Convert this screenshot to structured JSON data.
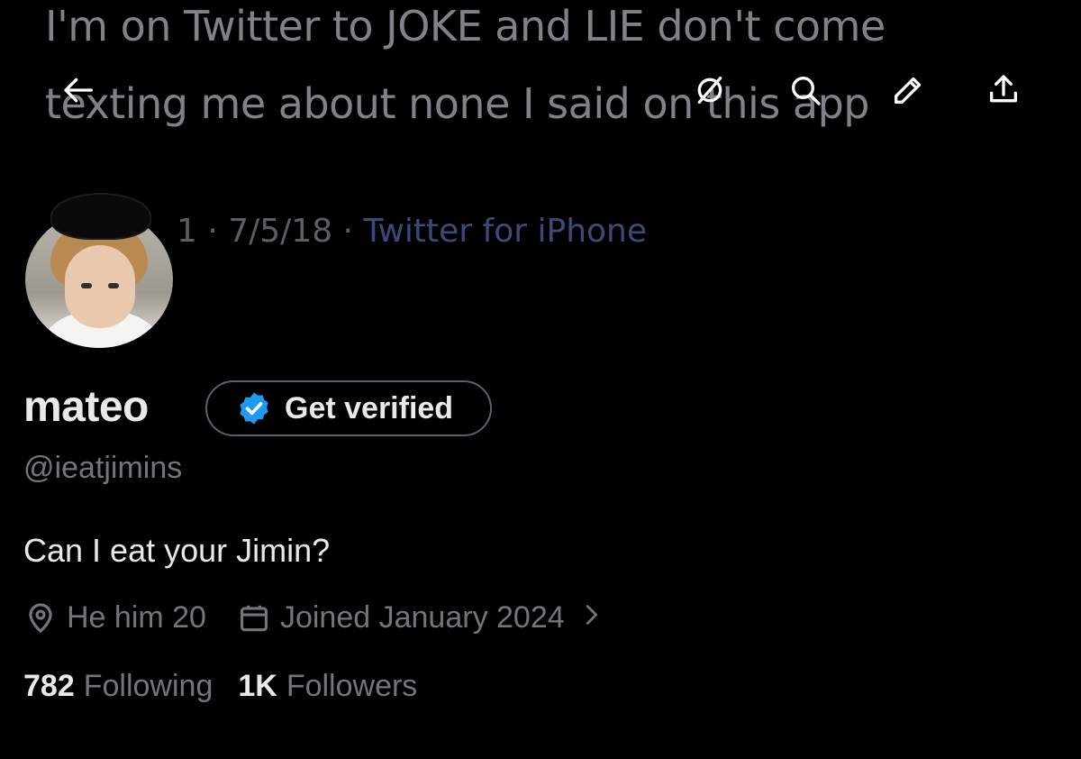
{
  "banner": {
    "line1": "I'm on Twitter to JOKE and LIE don't come",
    "line2": "texting me about none I said on this app",
    "meta_date": "1 · 7/5/18 · ",
    "meta_source": "Twitter for iPhone"
  },
  "nav": {
    "back_icon": "arrow-left-icon",
    "grok_icon": "grok-icon",
    "search_icon": "search-icon",
    "edit_icon": "pencil-icon",
    "share_icon": "share-icon"
  },
  "profile": {
    "display_name": "mateo",
    "get_verified_label": "Get verified",
    "handle": "@ieatjimins",
    "bio": "Can I eat your Jimin?",
    "location": "He him 20",
    "joined": "Joined January 2024",
    "following_count": "782",
    "following_label": "Following",
    "followers_count": "1K",
    "followers_label": "Followers"
  },
  "colors": {
    "background": "#000000",
    "primary_text": "#e7e9ea",
    "secondary_text": "#71767b",
    "verified_blue": "#1d9bf0",
    "pill_border": "#536471"
  }
}
